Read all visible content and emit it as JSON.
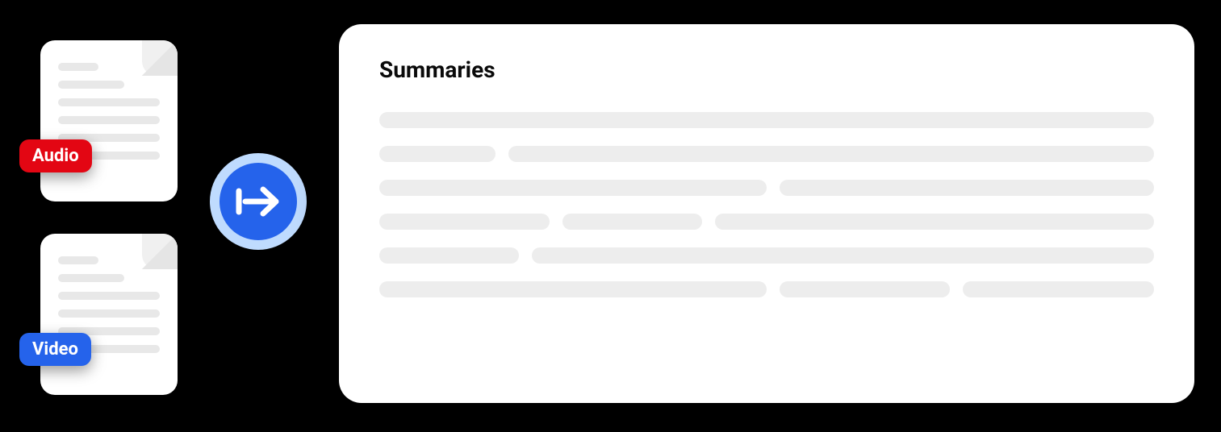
{
  "files": {
    "audio": {
      "badge": "Audio"
    },
    "video": {
      "badge": "Video"
    }
  },
  "panel": {
    "title": "Summaries"
  },
  "colors": {
    "audio_badge": "#e30613",
    "video_badge": "#2563eb",
    "arrow_bg": "#2563eb",
    "arrow_ring": "#bfdbfe",
    "placeholder": "#ededed"
  }
}
